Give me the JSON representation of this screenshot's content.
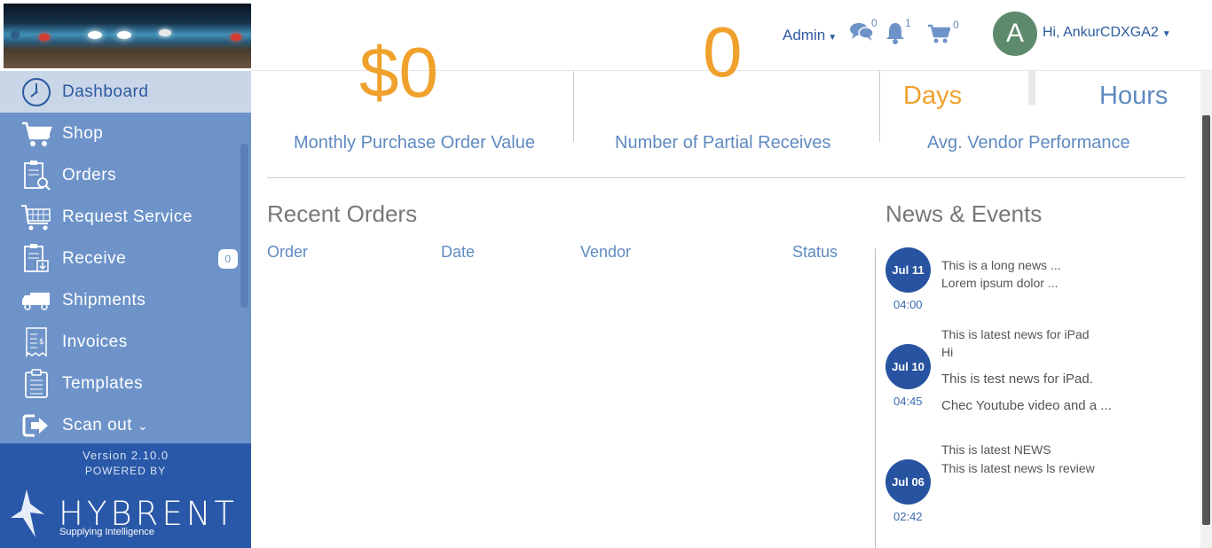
{
  "header": {
    "admin_label": "Admin",
    "messages_count": "0",
    "notifications_count": "1",
    "cart_count": "0",
    "avatar_letter": "A",
    "greeting": "Hi, AnkurCDXGA2"
  },
  "sidebar": {
    "items": [
      {
        "label": "Dashboard",
        "icon": "clock-icon"
      },
      {
        "label": "Shop",
        "icon": "cart-icon"
      },
      {
        "label": "Orders",
        "icon": "clipboard-search-icon"
      },
      {
        "label": "Request Service",
        "icon": "service-cart-icon"
      },
      {
        "label": "Receive",
        "icon": "receive-icon",
        "badge": "0"
      },
      {
        "label": "Shipments",
        "icon": "truck-icon"
      },
      {
        "label": "Invoices",
        "icon": "invoice-icon"
      },
      {
        "label": "Templates",
        "icon": "template-icon"
      },
      {
        "label": "Scan out",
        "icon": "sign-out-icon"
      }
    ],
    "version": "Version 2.10.0",
    "powered_by": "POWERED BY",
    "brand": "HYBRENT",
    "tagline": "Supplying Intelligence"
  },
  "kpis": {
    "purchase_value": "$0",
    "purchase_label": "Monthly Purchase Order Value",
    "partial_value": "0",
    "partial_label": "Number of Partial Receives",
    "days_unit": "Days",
    "hours_unit": "Hours",
    "vendor_label": "Avg. Vendor Performance"
  },
  "recent_orders": {
    "title": "Recent Orders",
    "columns": [
      "Order",
      "Date",
      "Vendor",
      "Status"
    ]
  },
  "news": {
    "title": "News & Events",
    "items": [
      {
        "date": "Jul 11",
        "time": "04:00",
        "lines": [
          "This is a long news ...",
          "Lorem ipsum dolor ..."
        ]
      },
      {
        "date": "Jul 10",
        "time": "04:45",
        "lines": [
          "This is latest news for iPad",
          "Hi",
          "This is test news for iPad.",
          "Chec Youtube video and a ..."
        ]
      },
      {
        "date": "Jul 06",
        "time": "02:42",
        "lines": [
          "This is latest NEWS",
          "This is latest news ls review"
        ]
      }
    ]
  },
  "colors": {
    "accent_orange": "#f0a12c",
    "primary_blue": "#2c5aa0",
    "sidebar_blue": "#6d93c9",
    "footer_blue": "#2a58a8"
  }
}
